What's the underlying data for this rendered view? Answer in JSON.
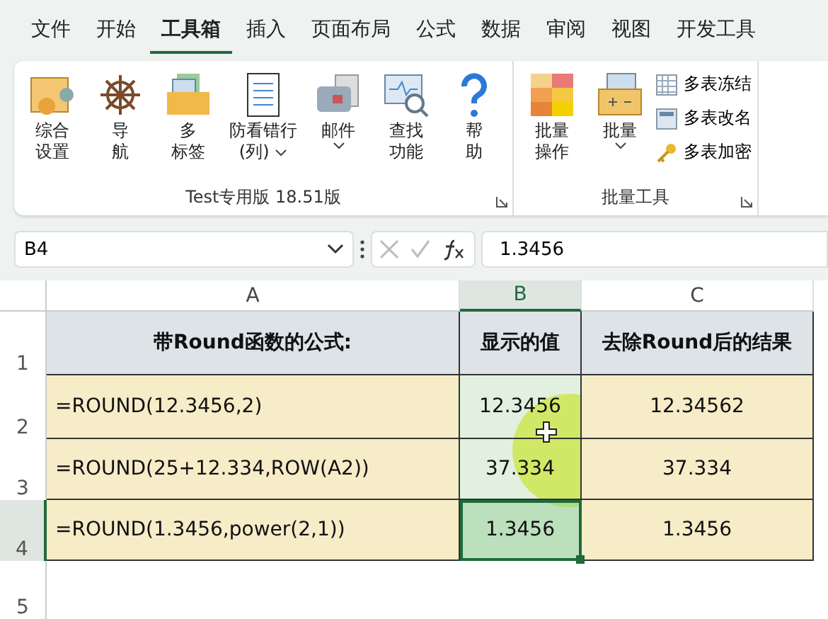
{
  "menu_tabs": [
    {
      "label": "文件",
      "selected": false
    },
    {
      "label": "开始",
      "selected": false
    },
    {
      "label": "工具箱",
      "selected": true
    },
    {
      "label": "插入",
      "selected": false
    },
    {
      "label": "页面布局",
      "selected": false
    },
    {
      "label": "公式",
      "selected": false
    },
    {
      "label": "数据",
      "selected": false
    },
    {
      "label": "审阅",
      "selected": false
    },
    {
      "label": "视图",
      "selected": false
    },
    {
      "label": "开发工具",
      "selected": false
    }
  ],
  "ribbon": {
    "groups": [
      {
        "label": "Test专用版 18.51版",
        "buttons": [
          {
            "lines": [
              "综合",
              "设置"
            ],
            "dropdown": false
          },
          {
            "lines": [
              "导",
              "航"
            ],
            "dropdown": false
          },
          {
            "lines": [
              "多",
              "标签"
            ],
            "dropdown": false
          },
          {
            "lines": [
              "防看错行",
              "(列)"
            ],
            "dropdown": true
          },
          {
            "lines": [
              "邮件"
            ],
            "dropdown": true
          },
          {
            "lines": [
              "查找",
              "功能"
            ],
            "dropdown": false
          },
          {
            "lines": [
              "帮",
              "助"
            ],
            "dropdown": false
          }
        ]
      },
      {
        "label": "批量工具",
        "buttons": [
          {
            "lines": [
              "批量",
              "操作"
            ],
            "dropdown": false
          },
          {
            "lines": [
              "批量"
            ],
            "dropdown": true
          }
        ],
        "small_buttons": [
          "多表冻结",
          "多表改名",
          "多表加密"
        ]
      }
    ]
  },
  "formula_bar": {
    "name_box": "B4",
    "formula": "1.3456"
  },
  "sheet": {
    "columns": [
      {
        "label": "A",
        "selected": false
      },
      {
        "label": "B",
        "selected": true
      },
      {
        "label": "C",
        "selected": false
      }
    ],
    "rows": [
      {
        "number": "1",
        "selected": false,
        "kind": "header",
        "cells": [
          {
            "text": "带Round函数的公式:"
          },
          {
            "text": "显示的值"
          },
          {
            "text": "去除Round后的结果"
          }
        ]
      },
      {
        "number": "2",
        "selected": false,
        "kind": "data",
        "cells": [
          {
            "text": "=ROUND(12.3456,2)",
            "selected": false
          },
          {
            "text": "12.3456",
            "selected": true
          },
          {
            "text": "12.34562",
            "selected": false
          }
        ]
      },
      {
        "number": "3",
        "selected": false,
        "kind": "data",
        "cells": [
          {
            "text": "=ROUND(25+12.334,ROW(A2))",
            "selected": false
          },
          {
            "text": "37.334",
            "selected": true
          },
          {
            "text": "37.334",
            "selected": false
          }
        ]
      },
      {
        "number": "4",
        "selected": true,
        "kind": "data",
        "cells": [
          {
            "text": "=ROUND(1.3456,power(2,1))",
            "selected": false
          },
          {
            "text": "1.3456",
            "selected": true,
            "active": true
          },
          {
            "text": "1.3456",
            "selected": false
          }
        ]
      },
      {
        "number": "5",
        "selected": false,
        "kind": "empty",
        "cells": []
      }
    ]
  }
}
